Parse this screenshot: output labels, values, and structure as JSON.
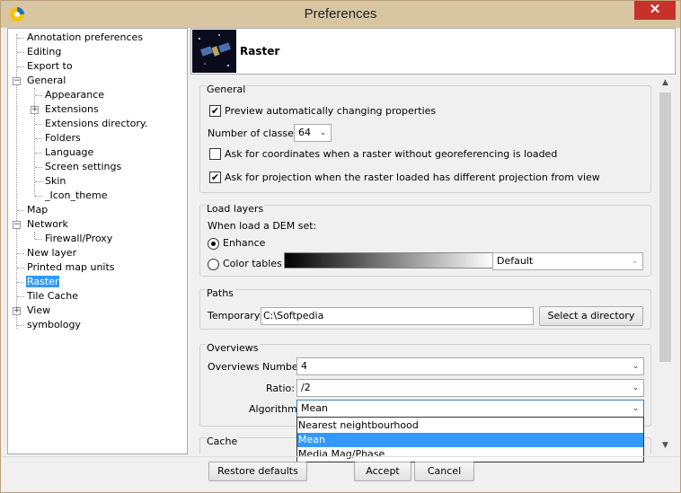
{
  "window": {
    "title": "Preferences",
    "close_label": "✕"
  },
  "tree": {
    "items": [
      {
        "label": "Annotation preferences"
      },
      {
        "label": "Editing"
      },
      {
        "label": "Export to"
      },
      {
        "label": "General"
      },
      {
        "label": "Appearance"
      },
      {
        "label": "Extensions"
      },
      {
        "label": "Extensions directory."
      },
      {
        "label": "Folders"
      },
      {
        "label": "Language"
      },
      {
        "label": "Screen settings"
      },
      {
        "label": "Skin"
      },
      {
        "label": "_Icon_theme"
      },
      {
        "label": "Map"
      },
      {
        "label": "Network"
      },
      {
        "label": "Firewall/Proxy"
      },
      {
        "label": "New layer"
      },
      {
        "label": "Printed map units"
      },
      {
        "label": "Raster"
      },
      {
        "label": "Tile Cache"
      },
      {
        "label": "View"
      },
      {
        "label": "symbology"
      }
    ],
    "expanded_symbol": "−",
    "collapsed_symbol": "+"
  },
  "panel": {
    "title": "Raster"
  },
  "general": {
    "title": "General",
    "preview_label": "Preview automatically changing properties",
    "preview_checked": "✔",
    "classes_label": "Number of classes:",
    "classes_value": "64",
    "ask_coords_label": "Ask for coordinates when a raster without georeferencing is loaded",
    "ask_proj_label": "Ask for projection when the raster loaded has different projection from view",
    "ask_proj_checked": "✔"
  },
  "load_layers": {
    "title": "Load layers",
    "dem_label": "When load a DEM set:",
    "enhance_label": "Enhance",
    "color_tables_label": "Color tables",
    "color_table_value": "Default"
  },
  "paths": {
    "title": "Paths",
    "temporary_label": "Temporary:",
    "temporary_value": "C:\\Softpedia",
    "select_dir_label": "Select a directory"
  },
  "overviews": {
    "title": "Overviews",
    "number_label": "Overviews Number:",
    "number_value": "4",
    "ratio_label": "Ratio:",
    "ratio_value": "/2",
    "algorithm_label": "Algorithm:",
    "algorithm_value": "Mean",
    "algorithm_options": [
      "Nearest neightbourhood",
      "Mean",
      "Media Mag/Phase"
    ]
  },
  "cache": {
    "title": "Cache"
  },
  "footer": {
    "restore_label": "Restore defaults",
    "accept_label": "Accept",
    "cancel_label": "Cancel"
  },
  "icons": {
    "dropdown_arrow": "⌄",
    "scroll_up": "▲",
    "scroll_down": "▼"
  }
}
